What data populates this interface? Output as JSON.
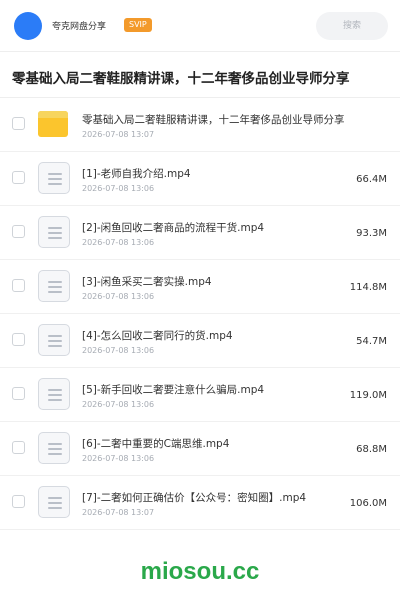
{
  "header": {
    "user_name": "夸克网盘分享",
    "badge": "SVIP",
    "search_label": "搜索"
  },
  "title": "零基础入局二奢鞋服精讲课，十二年奢侈品创业导师分享",
  "files": [
    {
      "type": "folder",
      "name": "零基础入局二奢鞋服精讲课，十二年奢侈品创业导师分享",
      "date": "2026-07-08 13:07",
      "size": ""
    },
    {
      "type": "file",
      "name": "[1]-老师自我介绍.mp4",
      "date": "2026-07-08 13:06",
      "size": "66.4M"
    },
    {
      "type": "file",
      "name": "[2]-闲鱼回收二奢商品的流程干货.mp4",
      "date": "2026-07-08 13:06",
      "size": "93.3M"
    },
    {
      "type": "file",
      "name": "[3]-闲鱼采买二奢实操.mp4",
      "date": "2026-07-08 13:06",
      "size": "114.8M"
    },
    {
      "type": "file",
      "name": "[4]-怎么回收二奢同行的货.mp4",
      "date": "2026-07-08 13:06",
      "size": "54.7M"
    },
    {
      "type": "file",
      "name": "[5]-新手回收二奢要注意什么骗局.mp4",
      "date": "2026-07-08 13:06",
      "size": "119.0M"
    },
    {
      "type": "file",
      "name": "[6]-二奢中重要的C端思维.mp4",
      "date": "2026-07-08 13:06",
      "size": "68.8M"
    },
    {
      "type": "file",
      "name": "[7]-二奢如何正确估价【公众号：密知圈】.mp4",
      "date": "2026-07-08 13:07",
      "size": "106.0M"
    }
  ],
  "watermark": "miosou.cc",
  "colors": {
    "avatar": "#2b7cf7",
    "badge": "#f39a2b",
    "folder": "#fbc52d",
    "watermark": "#2aa84a"
  }
}
